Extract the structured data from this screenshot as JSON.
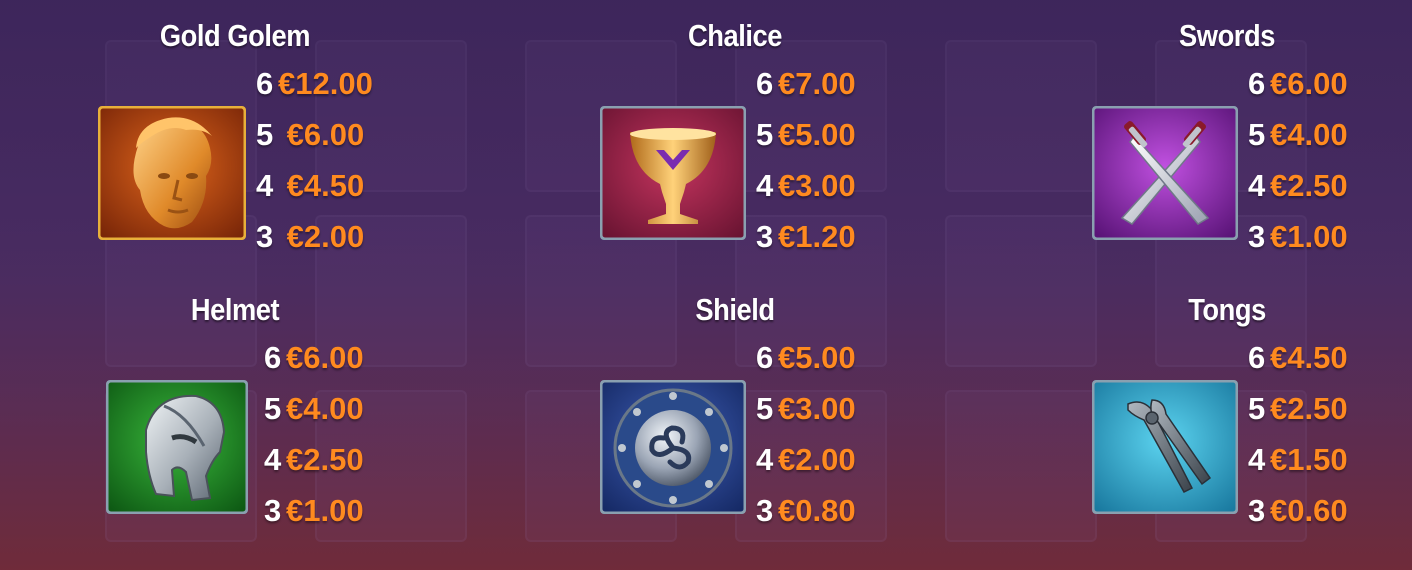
{
  "paytable": {
    "symbols": [
      {
        "name": "Gold Golem",
        "icon": "gold-golem-icon",
        "payouts": [
          {
            "count": "6",
            "value": "€12.00"
          },
          {
            "count": "5",
            "value": " €6.00"
          },
          {
            "count": "4",
            "value": " €4.50"
          },
          {
            "count": "3",
            "value": " €2.00"
          }
        ]
      },
      {
        "name": "Chalice",
        "icon": "chalice-icon",
        "payouts": [
          {
            "count": "6",
            "value": "€7.00"
          },
          {
            "count": "5",
            "value": "€5.00"
          },
          {
            "count": "4",
            "value": "€3.00"
          },
          {
            "count": "3",
            "value": "€1.20"
          }
        ]
      },
      {
        "name": "Swords",
        "icon": "swords-icon",
        "payouts": [
          {
            "count": "6",
            "value": "€6.00"
          },
          {
            "count": "5",
            "value": "€4.00"
          },
          {
            "count": "4",
            "value": "€2.50"
          },
          {
            "count": "3",
            "value": "€1.00"
          }
        ]
      },
      {
        "name": "Helmet",
        "icon": "helmet-icon",
        "payouts": [
          {
            "count": "6",
            "value": "€6.00"
          },
          {
            "count": "5",
            "value": "€4.00"
          },
          {
            "count": "4",
            "value": "€2.50"
          },
          {
            "count": "3",
            "value": "€1.00"
          }
        ]
      },
      {
        "name": "Shield",
        "icon": "shield-icon",
        "payouts": [
          {
            "count": "6",
            "value": "€5.00"
          },
          {
            "count": "5",
            "value": "€3.00"
          },
          {
            "count": "4",
            "value": "€2.00"
          },
          {
            "count": "3",
            "value": "€0.80"
          }
        ]
      },
      {
        "name": "Tongs",
        "icon": "tongs-icon",
        "payouts": [
          {
            "count": "6",
            "value": "€4.50"
          },
          {
            "count": "5",
            "value": "€2.50"
          },
          {
            "count": "4",
            "value": "€1.50"
          },
          {
            "count": "3",
            "value": "€0.60"
          }
        ]
      }
    ]
  },
  "colors": {
    "count_text": "#ffffff",
    "value_text": "#ff8a1f",
    "gold_tile": "#b84a12",
    "chalice_tile": "#a8284e",
    "swords_tile": "#9a2fb5",
    "helmet_tile": "#1f8f2a",
    "shield_tile": "#2a4f9e",
    "tongs_tile": "#2fa9cf"
  }
}
